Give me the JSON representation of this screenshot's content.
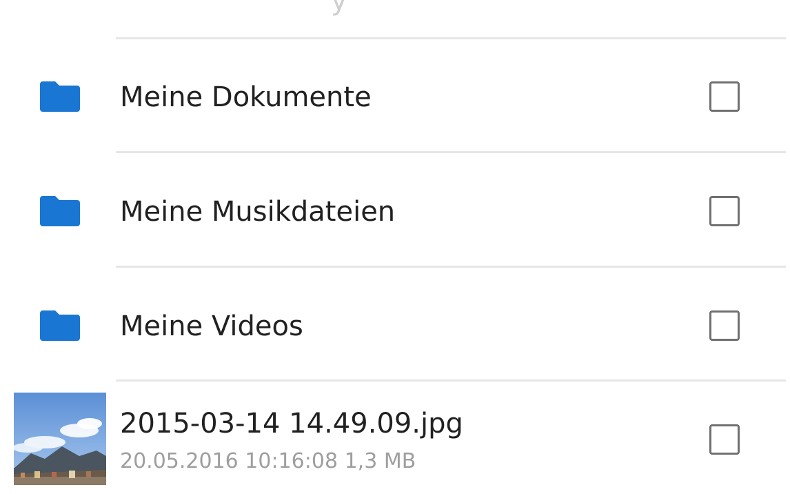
{
  "items": [
    {
      "name": "Meine Dokumente",
      "icon": "folder-icon",
      "checked": false
    },
    {
      "name": "Meine Musikdateien",
      "icon": "folder-icon",
      "checked": false
    },
    {
      "name": "Meine Videos",
      "icon": "folder-icon",
      "checked": false
    },
    {
      "name": "2015-03-14 14.49.09.jpg",
      "meta": "20.05.2016 10:16:08 1,3 MB",
      "icon": "image-thumbnail",
      "checked": false
    }
  ],
  "colors": {
    "folder": "#1976d2",
    "text": "#212121",
    "meta": "#9e9e9e",
    "divider": "#e6e6e6",
    "checkbox_border": "#707070"
  }
}
